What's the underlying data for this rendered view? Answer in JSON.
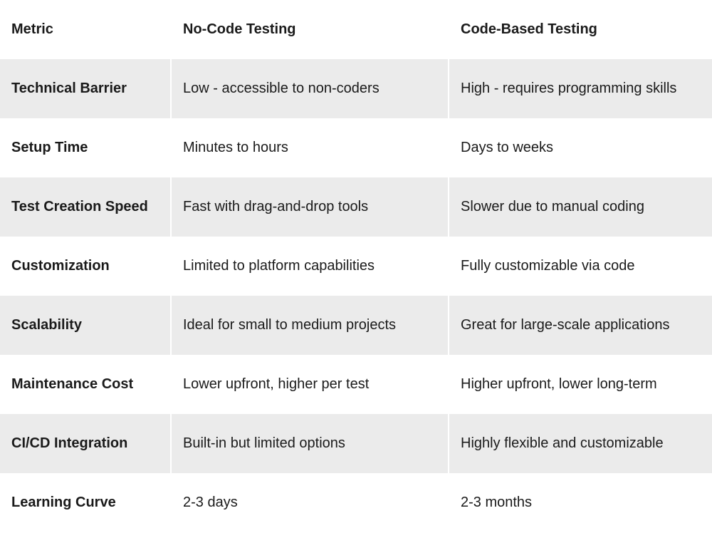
{
  "table": {
    "headers": {
      "metric": "Metric",
      "nocode": "No-Code Testing",
      "codebased": "Code-Based Testing"
    },
    "rows": [
      {
        "metric": "Technical Barrier",
        "nocode": "Low - accessible to non-coders",
        "codebased": "High - requires programming skills"
      },
      {
        "metric": "Setup Time",
        "nocode": "Minutes to hours",
        "codebased": "Days to weeks"
      },
      {
        "metric": "Test Creation Speed",
        "nocode": "Fast with drag-and-drop tools",
        "codebased": "Slower due to manual coding"
      },
      {
        "metric": "Customization",
        "nocode": "Limited to platform capabilities",
        "codebased": "Fully customizable via code"
      },
      {
        "metric": "Scalability",
        "nocode": "Ideal for small to medium projects",
        "codebased": "Great for large-scale applications"
      },
      {
        "metric": "Maintenance Cost",
        "nocode": "Lower upfront, higher per test",
        "codebased": "Higher upfront, lower long-term"
      },
      {
        "metric": "CI/CD Integration",
        "nocode": "Built-in but limited options",
        "codebased": "Highly flexible and customizable"
      },
      {
        "metric": "Learning Curve",
        "nocode": "2-3 days",
        "codebased": "2-3 months"
      }
    ]
  }
}
